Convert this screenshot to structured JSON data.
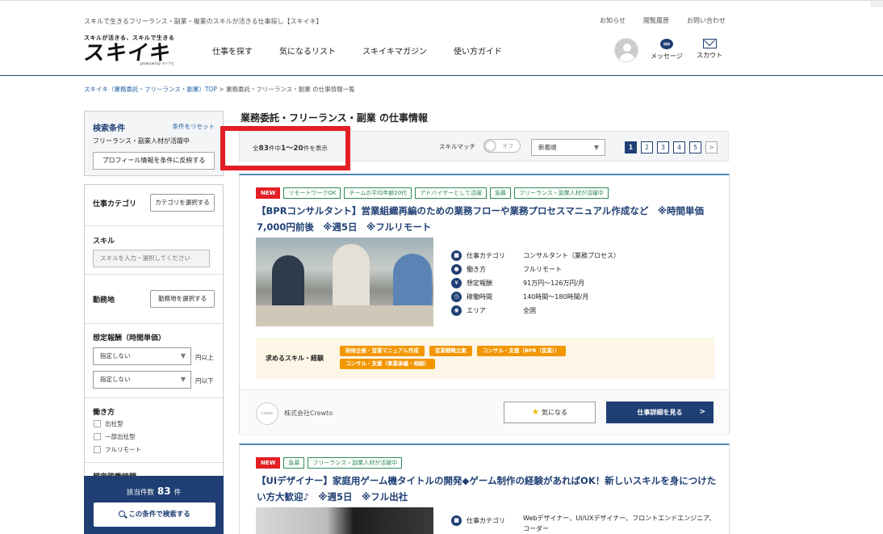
{
  "header": {
    "tagline": "スキルで生きるフリーランス・副業・複業のスキルが活きる仕事探し【スキイキ】",
    "util_links": [
      "お知らせ",
      "閲覧履歴",
      "お問い合わせ"
    ],
    "logo": {
      "slogan": "スキルが活きる、スキルで生きる",
      "brand": "スキイキ",
      "produced": "produced by マイナビ"
    },
    "nav": [
      "仕事を探す",
      "気になるリスト",
      "スキイキマガジン",
      "使い方ガイド"
    ],
    "icons": {
      "message": "メッセージ",
      "scout": "スカウト"
    }
  },
  "breadcrumb": {
    "home": "スキイキ（業務委託・フリーランス・副業）TOP",
    "sep": ">",
    "current": "業務委託・フリーランス・副業 の仕事情報一覧"
  },
  "sidebar": {
    "conditions": {
      "title": "検索条件",
      "reset": "条件をリセット",
      "active": "フリーランス・副業人材が活躍中",
      "profile_button": "プロフィール情報を条件に反映する"
    },
    "category": {
      "label": "仕事カテゴリ",
      "button": "カテゴリを選択する"
    },
    "skill": {
      "label": "スキル",
      "placeholder": "スキルを入力・選択してください"
    },
    "location": {
      "label": "勤務地",
      "button": "勤務地を選択する"
    },
    "pay": {
      "label": "想定報酬（時間単価）",
      "min": "指定しない",
      "min_unit": "円以上",
      "max": "指定しない",
      "max_unit": "円以下"
    },
    "work_style": {
      "label": "働き方",
      "options": [
        "出社型",
        "一部出社型",
        "フルリモート"
      ]
    },
    "hours_label": "想定稼働時間",
    "result": {
      "label": "該当件数",
      "count": "83",
      "unit": "件",
      "search_button": "この条件で検索する"
    }
  },
  "main": {
    "title": "業務委託・フリーランス・副業 の仕事情報",
    "total": {
      "prefix": "全",
      "total": "83",
      "mid": "件中",
      "range": "1〜20",
      "suffix": "件を表示"
    },
    "skill_match": {
      "label": "スキルマッチ",
      "state": "オフ"
    },
    "sort": "新着順",
    "pages": [
      "1",
      "2",
      "3",
      "4",
      "5",
      ">"
    ],
    "jobs": [
      {
        "tags": [
          "NEW",
          "リモートワークOK",
          "チームの平均年齢20代",
          "アドバイザーとして活躍",
          "急募",
          "フリーランス・副業人材が活躍中"
        ],
        "title": "【BPRコンサルタント】営業組織再編のための業務フローや業務プロセスマニュアル作成など　※時間単価7,000円前後　※週5日　※フルリモート",
        "details": [
          {
            "icon": "briefcase-icon",
            "key": "仕事カテゴリ",
            "value": "コンサルタント（業務プロセス）"
          },
          {
            "icon": "person-icon",
            "key": "働き方",
            "value": "フルリモート"
          },
          {
            "icon": "yen-icon",
            "key": "想定報酬",
            "value": "91万円〜126万円/月"
          },
          {
            "icon": "clock-icon",
            "key": "稼働時間",
            "value": "140時間〜180時間/月"
          },
          {
            "icon": "pin-icon",
            "key": "エリア",
            "value": "全国"
          }
        ],
        "skills_label": "求めるスキル・経験",
        "skills": [
          "研修企画・営業マニュアル作成",
          "営業戦略立案",
          "コンサル・支援（BPR（営業））",
          "コンサル・支援（事業承継・相続）"
        ],
        "company": "株式会社Crewto",
        "company_logo": "Crewto",
        "fav_button": "気になる",
        "detail_button": "仕事詳細を見る"
      },
      {
        "tags": [
          "NEW",
          "急募",
          "フリーランス・副業人材が活躍中"
        ],
        "title": "【UIデザイナー】家庭用ゲーム機タイトルの開発◆ゲーム制作の経験があればOK！新しいスキルを身につけたい方大歓迎♪　※週5日　※フル出社",
        "details": [
          {
            "icon": "briefcase-icon",
            "key": "仕事カテゴリ",
            "value": "Webデザイナー、UI/UXデザイナー、フロントエンドエンジニア、コーダー"
          }
        ]
      }
    ]
  }
}
